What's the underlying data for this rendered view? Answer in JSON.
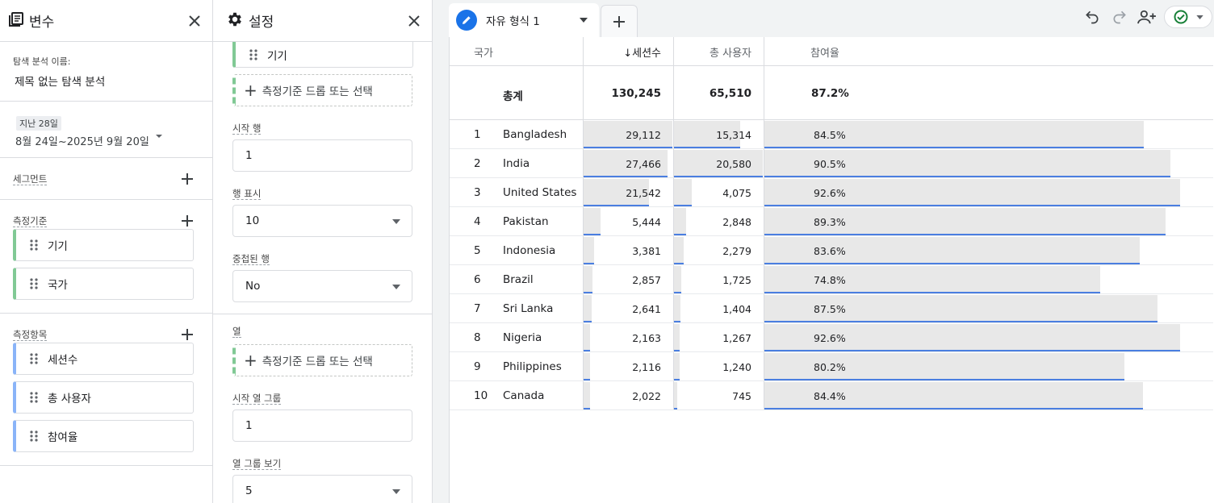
{
  "variables": {
    "title": "변수",
    "name_label": "탐색 분석 이름:",
    "name_value": "제목 없는 탐색 분석",
    "date_chip": "지난 28일",
    "date_range": "8월 24일~2025년 9월 20일",
    "segments_title": "세그먼트",
    "dimensions_title": "측정기준",
    "dimensions": [
      "기기",
      "국가"
    ],
    "metrics_title": "측정항목",
    "metrics": [
      "세션수",
      "총 사용자",
      "참여율"
    ]
  },
  "settings": {
    "title": "설정",
    "row_dimension": "기기",
    "drop_label": "측정기준 드롭 또는 선택",
    "start_row_label": "시작 행",
    "start_row_value": "1",
    "show_rows_label": "행 표시",
    "show_rows_value": "10",
    "nested_rows_label": "중첩된 행",
    "nested_rows_value": "No",
    "columns_label": "열",
    "column_drop_label": "측정기준 드롭 또는 선택",
    "start_col_group_label": "시작 열 그룹",
    "start_col_group_value": "1",
    "show_col_groups_label": "열 그룹 보기",
    "show_col_groups_value": "5"
  },
  "tab": {
    "name": "자유 형식 1"
  },
  "table": {
    "headers": {
      "country": "국가",
      "sessions": "↓세션수",
      "users": "총 사용자",
      "engagement": "참여율"
    },
    "total": {
      "label": "총계",
      "sessions": "130,245",
      "users": "65,510",
      "engagement": "87.2%"
    },
    "rows": [
      {
        "rank": "1",
        "country": "Bangladesh",
        "sessions": "29,112",
        "users": "15,314",
        "engagement": "84.5%",
        "s": 29112,
        "u": 15314,
        "e": 84.5
      },
      {
        "rank": "2",
        "country": "India",
        "sessions": "27,466",
        "users": "20,580",
        "engagement": "90.5%",
        "s": 27466,
        "u": 20580,
        "e": 90.5
      },
      {
        "rank": "3",
        "country": "United States",
        "sessions": "21,542",
        "users": "4,075",
        "engagement": "92.6%",
        "s": 21542,
        "u": 4075,
        "e": 92.6
      },
      {
        "rank": "4",
        "country": "Pakistan",
        "sessions": "5,444",
        "users": "2,848",
        "engagement": "89.3%",
        "s": 5444,
        "u": 2848,
        "e": 89.3
      },
      {
        "rank": "5",
        "country": "Indonesia",
        "sessions": "3,381",
        "users": "2,279",
        "engagement": "83.6%",
        "s": 3381,
        "u": 2279,
        "e": 83.6
      },
      {
        "rank": "6",
        "country": "Brazil",
        "sessions": "2,857",
        "users": "1,725",
        "engagement": "74.8%",
        "s": 2857,
        "u": 1725,
        "e": 74.8
      },
      {
        "rank": "7",
        "country": "Sri Lanka",
        "sessions": "2,641",
        "users": "1,404",
        "engagement": "87.5%",
        "s": 2641,
        "u": 1404,
        "e": 87.5
      },
      {
        "rank": "8",
        "country": "Nigeria",
        "sessions": "2,163",
        "users": "1,267",
        "engagement": "92.6%",
        "s": 2163,
        "u": 1267,
        "e": 92.6
      },
      {
        "rank": "9",
        "country": "Philippines",
        "sessions": "2,116",
        "users": "1,240",
        "engagement": "80.2%",
        "s": 2116,
        "u": 1240,
        "e": 80.2
      },
      {
        "rank": "10",
        "country": "Canada",
        "sessions": "2,022",
        "users": "745",
        "engagement": "84.4%",
        "s": 2022,
        "u": 745,
        "e": 84.4
      }
    ],
    "bar_color": "#e8e8e8",
    "bar_line_color": "#4a7ee0"
  },
  "icons": [
    "variables-icon",
    "close-icon",
    "gear-icon",
    "plus-icon",
    "drag-handle-icon",
    "pencil-icon",
    "undo-icon",
    "redo-icon",
    "share-user-icon",
    "check-circle-icon",
    "chevron-down-icon"
  ],
  "colors": {
    "accent": "#1a73e8",
    "dimension": "#81c995",
    "metric": "#8ab4f8",
    "ok": "#188038"
  }
}
